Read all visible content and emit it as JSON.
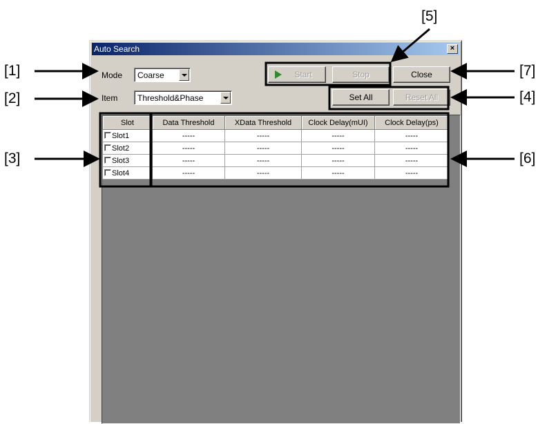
{
  "window": {
    "title": "Auto Search",
    "close_glyph": "×"
  },
  "mode": {
    "label": "Mode",
    "value": "Coarse"
  },
  "item": {
    "label": "Item",
    "value": "Threshold&Phase"
  },
  "buttons": {
    "start": "Start",
    "stop": "Stop",
    "close": "Close",
    "set_all": "Set All",
    "reset_all": "Reset All"
  },
  "table": {
    "columns": [
      "Slot",
      "Data Threshold",
      "XData Threshold",
      "Clock Delay(mUI)",
      "Clock Delay(ps)"
    ],
    "rows": [
      {
        "slot": "Slot1",
        "values": [
          "-----",
          "-----",
          "-----",
          "-----"
        ]
      },
      {
        "slot": "Slot2",
        "values": [
          "-----",
          "-----",
          "-----",
          "-----"
        ]
      },
      {
        "slot": "Slot3",
        "values": [
          "-----",
          "-----",
          "-----",
          "-----"
        ]
      },
      {
        "slot": "Slot4",
        "values": [
          "-----",
          "-----",
          "-----",
          "-----"
        ]
      }
    ]
  },
  "callouts": {
    "c1": "[1]",
    "c2": "[2]",
    "c3": "[3]",
    "c4": "[4]",
    "c5": "[5]",
    "c6": "[6]",
    "c7": "[7]"
  },
  "colors": {
    "title_gradient_start": "#0a246a",
    "title_gradient_end": "#a6caf0",
    "window_face": "#d4d0c8",
    "grid_background": "#808080",
    "start_icon": "#2e8b2e"
  }
}
